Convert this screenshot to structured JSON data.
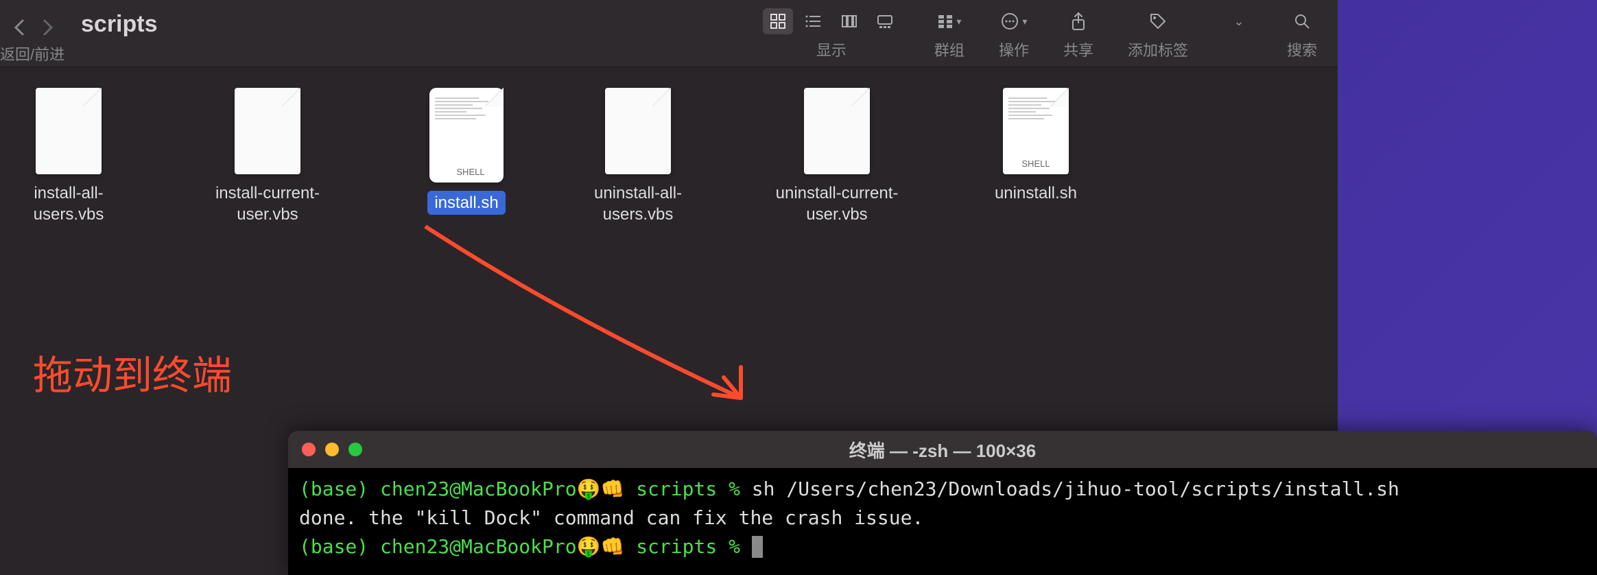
{
  "finder": {
    "title": "scripts",
    "nav_label": "返回/前进",
    "toolbar": {
      "view_label": "显示",
      "group_label": "群组",
      "action_label": "操作",
      "share_label": "共享",
      "tag_label": "添加标签",
      "search_label": "搜索"
    },
    "files": [
      {
        "name": "install-all-users.vbs",
        "type": "vbs",
        "selected": false
      },
      {
        "name": "install-current-user.vbs",
        "type": "vbs",
        "selected": false
      },
      {
        "name": "install.sh",
        "type": "shell",
        "selected": true
      },
      {
        "name": "uninstall-all-users.vbs",
        "type": "vbs",
        "selected": false
      },
      {
        "name": "uninstall-current-user.vbs",
        "type": "vbs",
        "selected": false
      },
      {
        "name": "uninstall.sh",
        "type": "shell",
        "selected": false
      }
    ],
    "shell_badge": "SHELL"
  },
  "annotation": {
    "text": "拖动到终端"
  },
  "terminal": {
    "title": "终端 — -zsh — 100×36",
    "prompt_env": "(base)",
    "prompt_userhost": "chen23@MacBookPro🤑👊",
    "prompt_dir": "scripts",
    "prompt_symbol": "%",
    "command": "sh /Users/chen23/Downloads/jihuo-tool/scripts/install.sh",
    "output": "done. the \"kill Dock\" command can fix the crash issue."
  }
}
